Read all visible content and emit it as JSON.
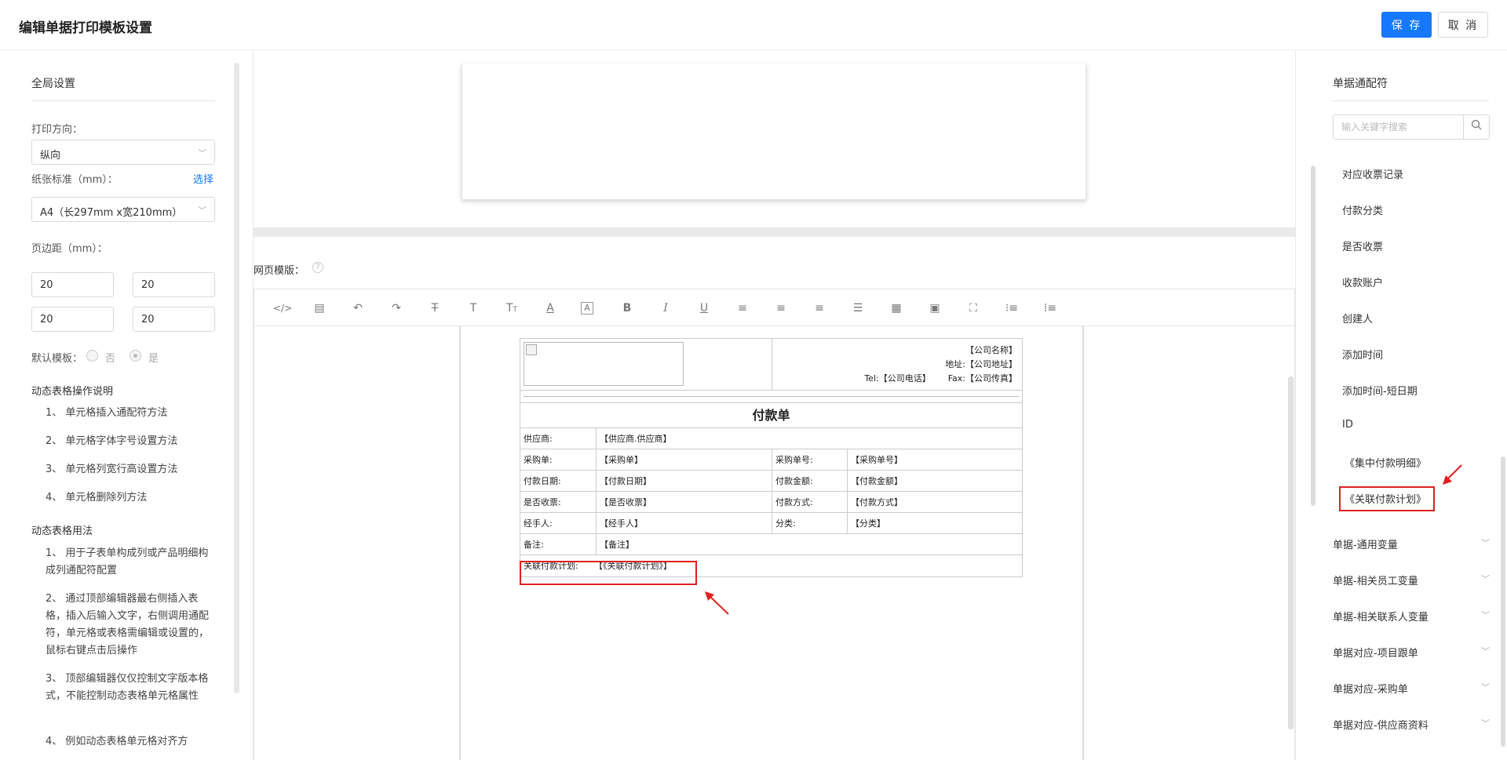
{
  "header": {
    "title": "编辑单据打印模板设置",
    "save": "保 存",
    "cancel": "取 消"
  },
  "left": {
    "global_title": "全局设置",
    "orientation_label": "打印方向：",
    "orientation_value": "纵向",
    "paper_label": "纸张标准（mm）：",
    "choose_link": "选择",
    "paper_value": "A4（长297mm x宽210mm）",
    "margin_label": "页边距（mm）：",
    "margins": [
      "20",
      "20",
      "20",
      "20"
    ],
    "default_label": "默认模板：",
    "opt_no": "否",
    "opt_yes": "是",
    "ops_title": "动态表格操作说明",
    "ops": [
      "1、 单元格插入通配符方法",
      "2、 单元格字体字号设置方法",
      "3、 单元格列宽行高设置方法",
      "4、 单元格删除列方法"
    ],
    "usage_title": "动态表格用法",
    "usage": [
      "1、 用于子表单构成列或产品明细构成列通配符配置",
      "2、 通过顶部编辑器最右侧插入表格，插入后输入文字，右侧调用通配符，单元格或表格需编辑或设置的，鼠标右键点击后操作",
      "3、 顶部编辑器仅仅控制文字版本格式，不能控制动态表格单元格属性",
      "4、 例如动态表格单元格对齐方"
    ]
  },
  "center": {
    "web_template_label": "网页模版：",
    "help_glyph": "?",
    "doc": {
      "company_name": "【公司名称】",
      "address": "地址:【公司地址】",
      "tel": "Tel:【公司电话】",
      "fax": "Fax:【公司传真】",
      "title": "付款单",
      "rows": [
        [
          {
            "l": "供应商:",
            "v": "【供应商.供应商】"
          }
        ],
        [
          {
            "l": "采购单:",
            "v": "【采购单】"
          },
          {
            "l": "采购单号:",
            "v": "【采购单号】"
          }
        ],
        [
          {
            "l": "付款日期:",
            "v": "【付款日期】"
          },
          {
            "l": "付款金额:",
            "v": "【付款金额】"
          }
        ],
        [
          {
            "l": "是否收票:",
            "v": "【是否收票】"
          },
          {
            "l": "付款方式:",
            "v": "【付款方式】"
          }
        ],
        [
          {
            "l": "经手人:",
            "v": "【经手人】"
          },
          {
            "l": "分类:",
            "v": "【分类】"
          }
        ],
        [
          {
            "l": "备注:",
            "v": "【备注】"
          }
        ],
        [
          {
            "l": "关联付款计划:",
            "v": "【《关联付款计划》】"
          }
        ]
      ]
    }
  },
  "right": {
    "title": "单据通配符",
    "search_placeholder": "输入关键字搜索",
    "items": [
      "对应收票记录",
      "付款分类",
      "是否收票",
      "收款账户",
      "创建人",
      "添加时间",
      "添加时间-短日期",
      "ID",
      "《集中付款明细》",
      "《关联付款计划》"
    ],
    "groups": [
      "单据-通用变量",
      "单据-相关员工变量",
      "单据-相关联系人变量",
      "单据对应-项目跟单",
      "单据对应-采购单",
      "单据对应-供应商资料"
    ]
  },
  "icons": {
    "annotation_color": "#e02020",
    "primary_color": "#1677ff"
  }
}
